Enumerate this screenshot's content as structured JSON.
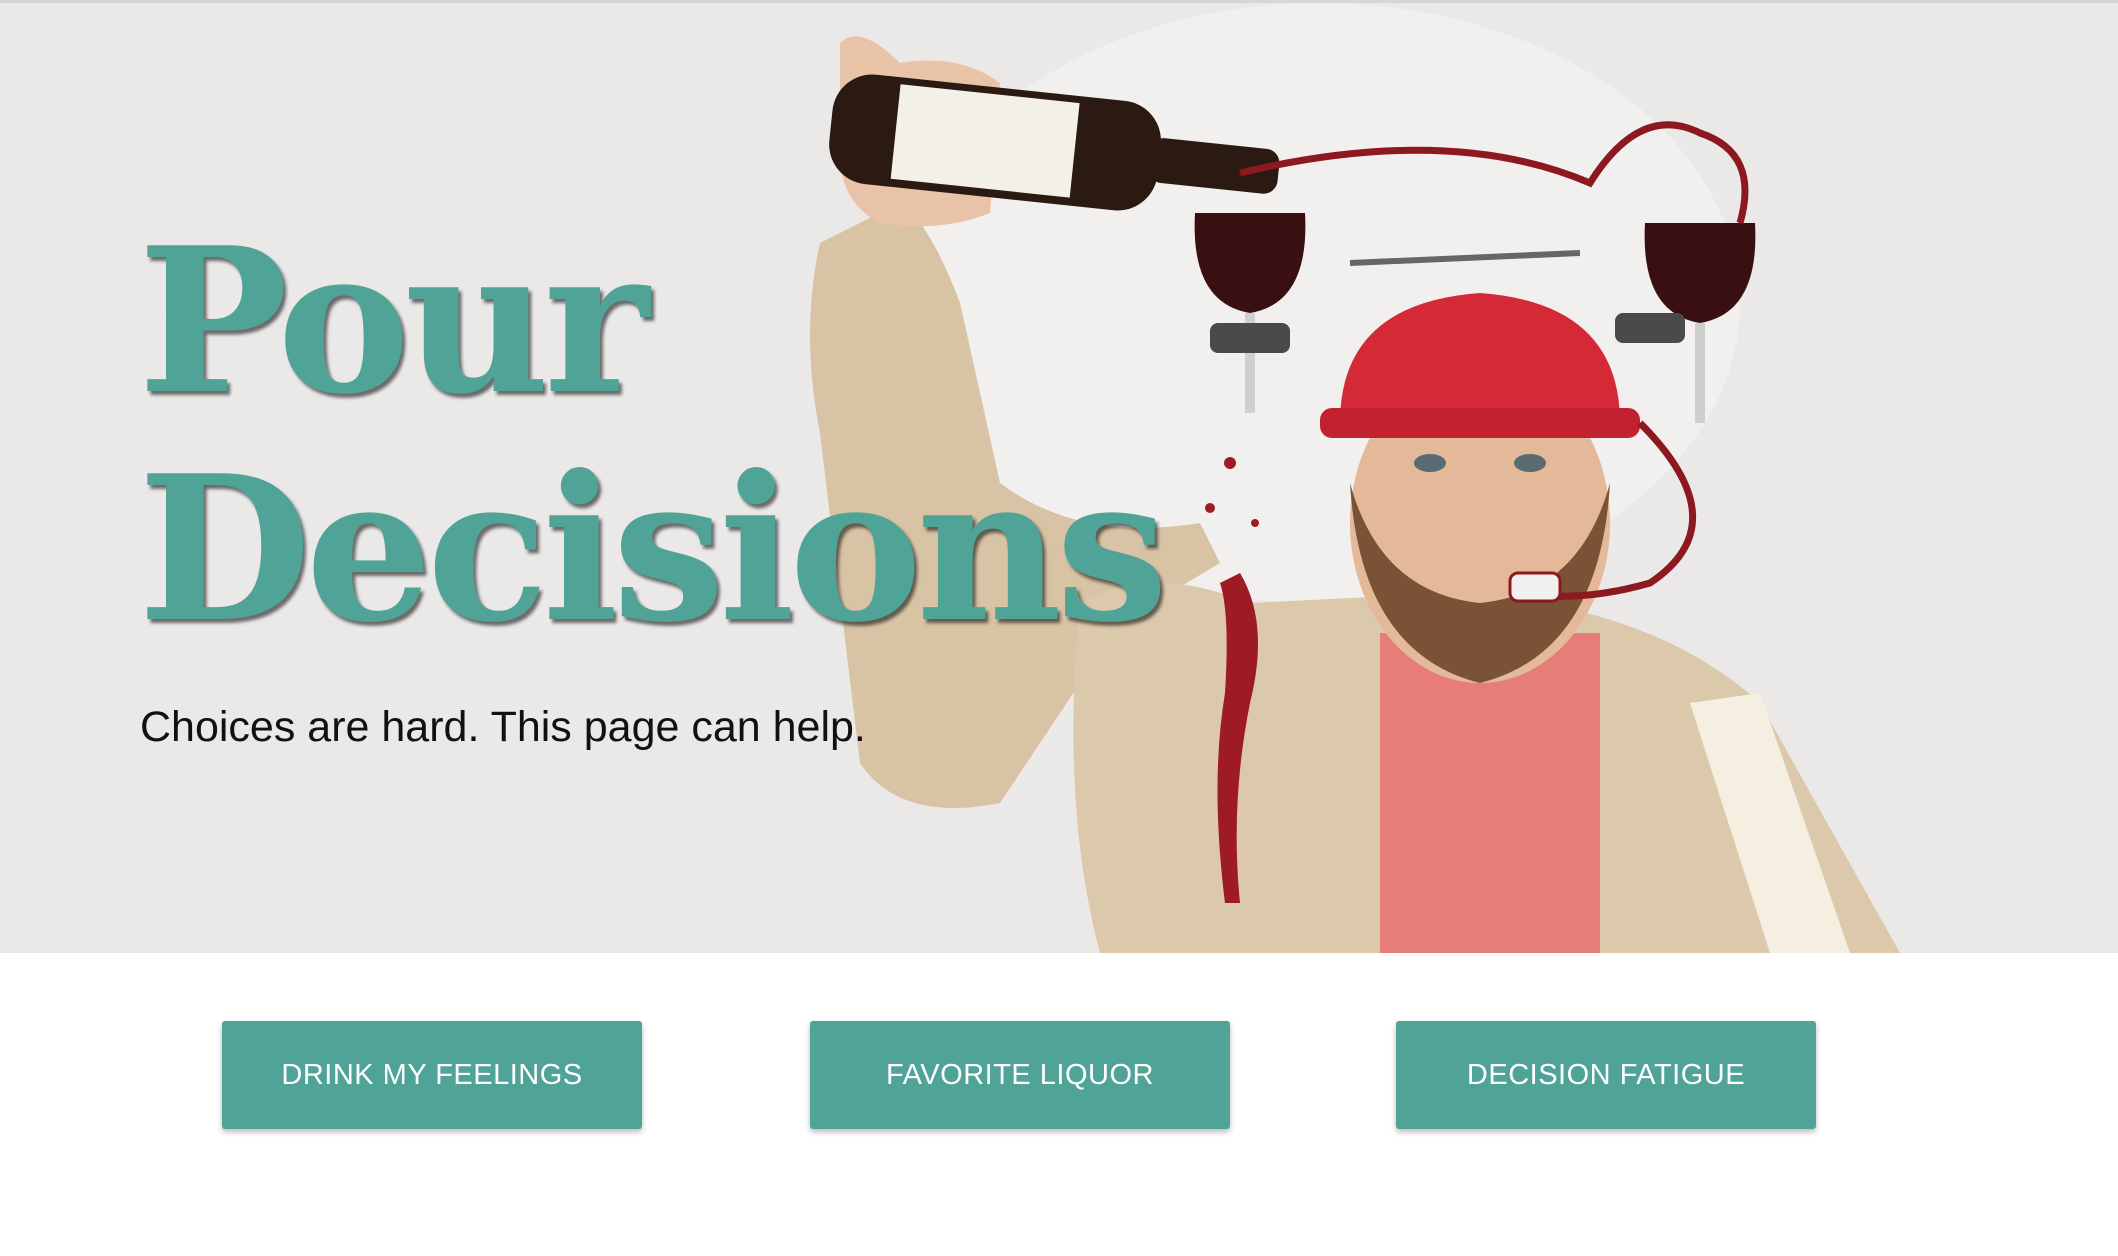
{
  "hero": {
    "title_line1": "Pour",
    "title_line2": "Decisions",
    "tagline": "Choices are hard. This page can help.",
    "image": "man-with-wine-drinking-helmet-photo"
  },
  "buttons": [
    {
      "label": "DRINK MY FEELINGS"
    },
    {
      "label": "FAVORITE LIQUOR"
    },
    {
      "label": "DECISION FATIGUE"
    }
  ],
  "colors": {
    "accent": "#4fa397",
    "hero_background": "#ebe9e8",
    "button_text": "#ffffff",
    "tagline_text": "#111111"
  }
}
